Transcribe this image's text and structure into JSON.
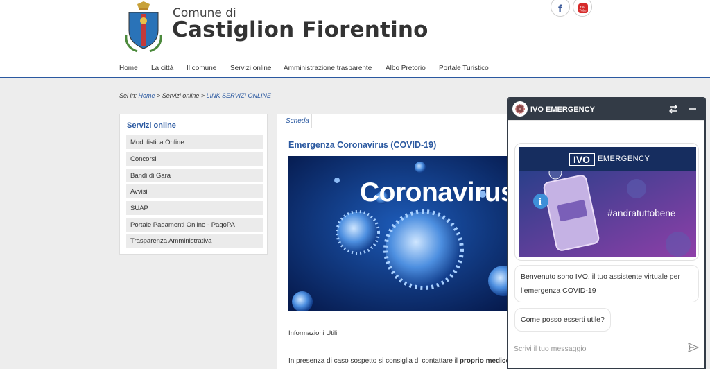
{
  "header": {
    "comune_di": "Comune di",
    "city": "Castiglion Fiorentino",
    "social": {
      "facebook": "f",
      "youtube": "You\nTube"
    }
  },
  "nav": {
    "items": [
      "Home",
      "La città",
      "Il comune",
      "Servizi online",
      "Amministrazione trasparente",
      "Albo Pretorio",
      "Portale Turistico"
    ]
  },
  "breadcrumb": {
    "prefix": "Sei in:",
    "home": "Home",
    "sep1": " > Servizi online > ",
    "current": "LINK SERVIZI ONLINE"
  },
  "sidebar": {
    "title": "Servizi online",
    "items": [
      "Modulistica Online",
      "Concorsi",
      "Bandi di Gara",
      "Avvisi",
      "SUAP",
      "Portale Pagamenti Online - PagoPA",
      "Trasparenza Amministrativa"
    ]
  },
  "main": {
    "tab": "Scheda",
    "title": "Emergenza Coronavirus (COVID-19)",
    "hero_text": "Coronavirus",
    "info_label": "Informazioni Utili",
    "para_start": "In presenza di caso sospetto si consiglia di contattare il ",
    "para_bold": "proprio medico o pediatra di base."
  },
  "chat": {
    "title": "IVO EMERGENCY",
    "banner_ivo": "IVO",
    "banner_emergency": "EMERGENCY",
    "banner_hashtag": "#andratuttobene",
    "msg1": "Benvenuto sono IVO, il tuo assistente virtuale per l’emergenza COVID-19",
    "msg2": "Come posso esserti utile?",
    "input_placeholder": "Scrivi il tuo messaggio"
  },
  "colors": {
    "accent": "#2b59a0",
    "chat_header": "#333b46",
    "background": "#ededed"
  }
}
